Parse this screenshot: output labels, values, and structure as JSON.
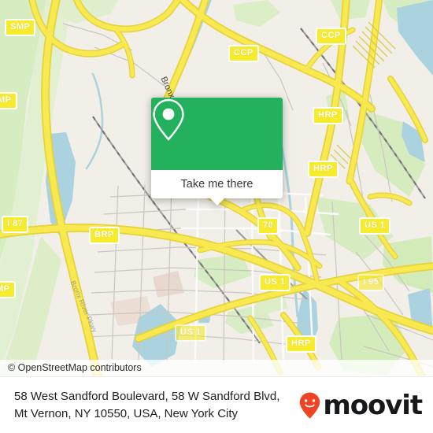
{
  "map": {
    "provider_attribution": "© OpenStreetMap contributors",
    "water_labels": [
      {
        "text": "Bronx River"
      }
    ],
    "street_labels": [
      {
        "text": "Bronx River Pkwy"
      }
    ],
    "road_shields": [
      {
        "label": "SMP"
      },
      {
        "label": "CCP"
      },
      {
        "label": "CCP"
      },
      {
        "label": "HRP"
      },
      {
        "label": "HRP"
      },
      {
        "label": "MP"
      },
      {
        "label": "I 87"
      },
      {
        "label": "BRP"
      },
      {
        "label": "70"
      },
      {
        "label": "US 1"
      },
      {
        "label": "US 1"
      },
      {
        "label": "I 95"
      },
      {
        "label": "US 1"
      },
      {
        "label": "HRP"
      },
      {
        "label": "MP"
      }
    ],
    "colors": {
      "land": "#f2efe9",
      "road_major": "#f7e94f",
      "road_minor": "#ffffff",
      "water": "#aad3df",
      "park": "#cfecb0",
      "rail": "#8a8a8a",
      "residential": "#e8e5de"
    }
  },
  "popup": {
    "icon": "map-pin-icon",
    "button_label": "Take me there",
    "accent_color": "#24b15e"
  },
  "footer": {
    "address_line1": "58 West Sandford Boulevard, 58 W Sandford Blvd,",
    "address_line2": "Mt Vernon, NY 10550, USA, New York City",
    "brand_name": "moovit",
    "brand_icon": "moovit-pin-icon",
    "brand_color": "#ef4323"
  }
}
